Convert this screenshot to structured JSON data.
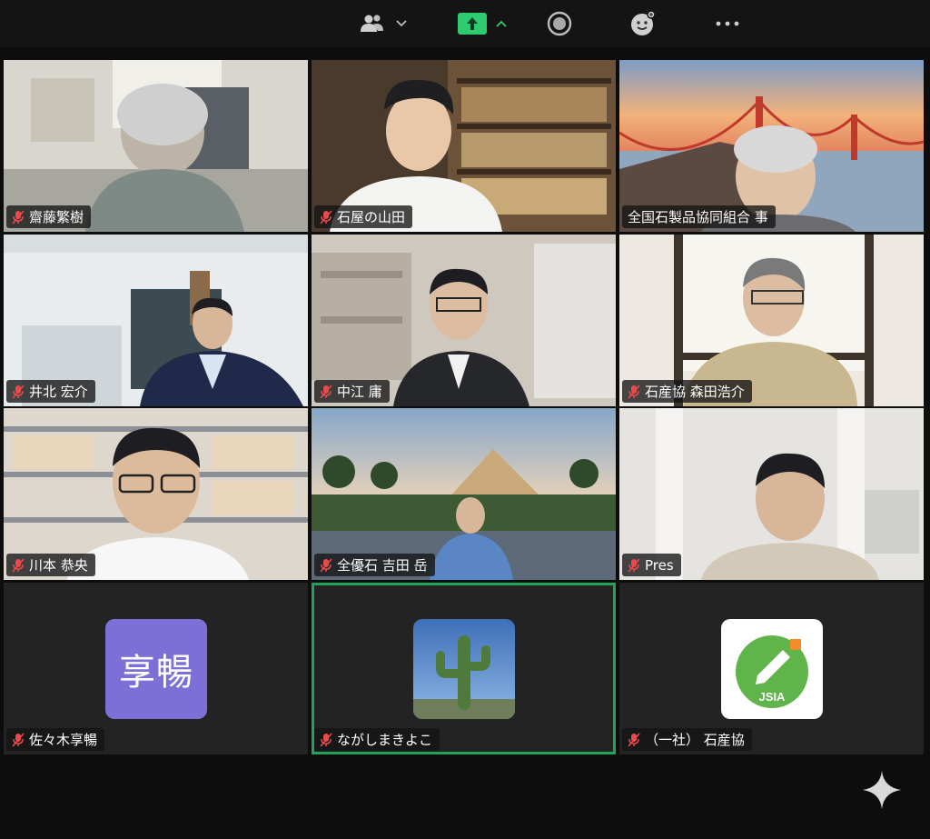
{
  "toolbar": {
    "participants_icon": "participants-icon",
    "share_icon": "share-screen-icon",
    "record_icon": "record-icon",
    "reactions_icon": "reactions-icon",
    "more_icon": "more-icon",
    "share_color": "#2ecc71"
  },
  "participants": [
    {
      "name": "齋藤繁樹",
      "muted": true
    },
    {
      "name": "石屋の山田",
      "muted": true
    },
    {
      "name": "全国石製品協同組合 事",
      "muted": false
    },
    {
      "name": "井北 宏介",
      "muted": true
    },
    {
      "name": "中江 庸",
      "muted": true
    },
    {
      "name": "石産協 森田浩介",
      "muted": true
    },
    {
      "name": "川本 恭央",
      "muted": true
    },
    {
      "name": "全優石 吉田 岳",
      "muted": true
    },
    {
      "name": "Pres",
      "muted": true
    },
    {
      "name": "佐々木享暢",
      "muted": true,
      "avatar_text": "享暢"
    },
    {
      "name": "ながしまきよこ",
      "muted": true,
      "active_speaker": true
    },
    {
      "name": "（一社） 石産協",
      "muted": true,
      "logo_text": "JSIA"
    }
  ]
}
